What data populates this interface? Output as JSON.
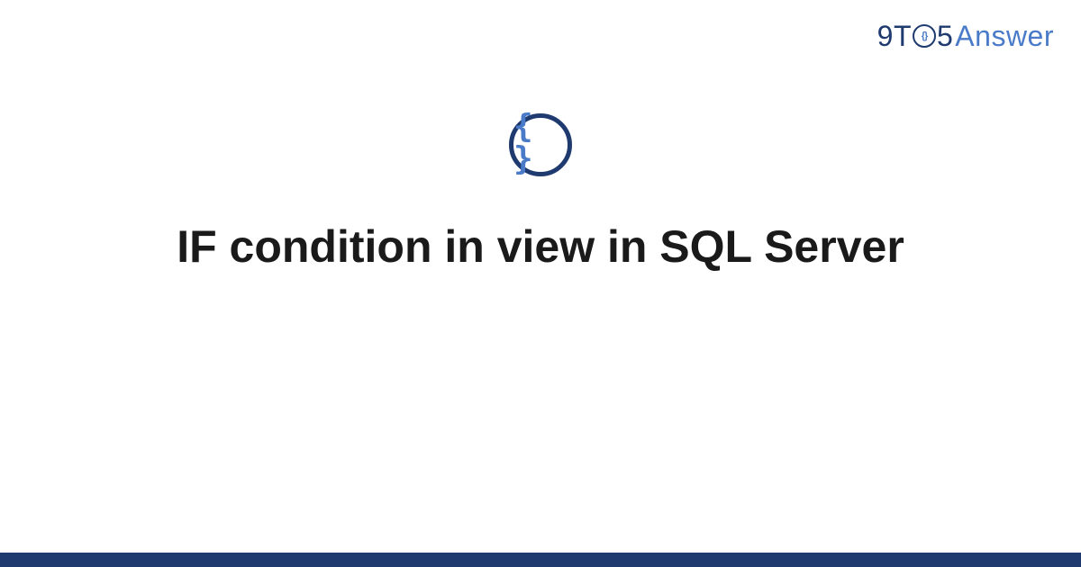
{
  "logo": {
    "part1": "9T",
    "clock_inner": "{}",
    "part2": "5",
    "part3": "Answer"
  },
  "icon": {
    "braces": "{ }"
  },
  "title": "IF condition in view in SQL Server",
  "colors": {
    "primary_dark": "#1f3a6e",
    "primary_light": "#4a7bc8",
    "text": "#1a1a1a"
  }
}
